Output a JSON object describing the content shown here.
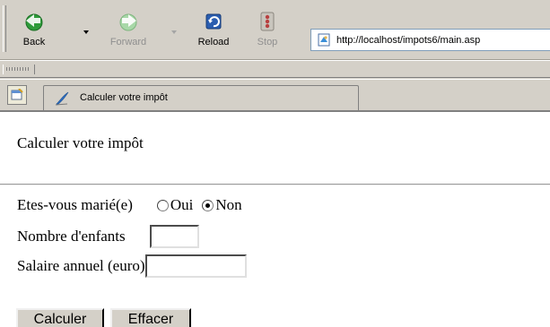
{
  "toolbar": {
    "back": {
      "label": "Back",
      "icon": "back-arrow-icon"
    },
    "forward": {
      "label": "Forward",
      "icon": "forward-arrow-icon"
    },
    "reload": {
      "label": "Reload",
      "icon": "reload-icon"
    },
    "stop": {
      "label": "Stop",
      "icon": "stop-icon"
    }
  },
  "address": {
    "url": "http://localhost/impots6/main.asp",
    "icon": "page-icon"
  },
  "tabs": [
    {
      "label": "Calculer votre impôt",
      "icon": "tab-feather-icon"
    }
  ],
  "page": {
    "title": "Calculer votre impôt",
    "married_label": "Etes-vous marié(e)",
    "married_options": [
      {
        "label": "Oui",
        "checked": false
      },
      {
        "label": "Non",
        "checked": true
      }
    ],
    "children_label": "Nombre d'enfants",
    "children_value": "",
    "salary_label": "Salaire annuel (euro)",
    "salary_value": "",
    "buttons": {
      "calculate": "Calculer",
      "reset": "Effacer"
    }
  },
  "colors": {
    "chrome": "#d4d0c8",
    "page_bg": "#ffffff",
    "back_icon": "#2f8f2f",
    "forward_icon": "#9ccf9c",
    "reload_icon": "#1f4f9f",
    "stop_icon": "#b83a3a"
  }
}
